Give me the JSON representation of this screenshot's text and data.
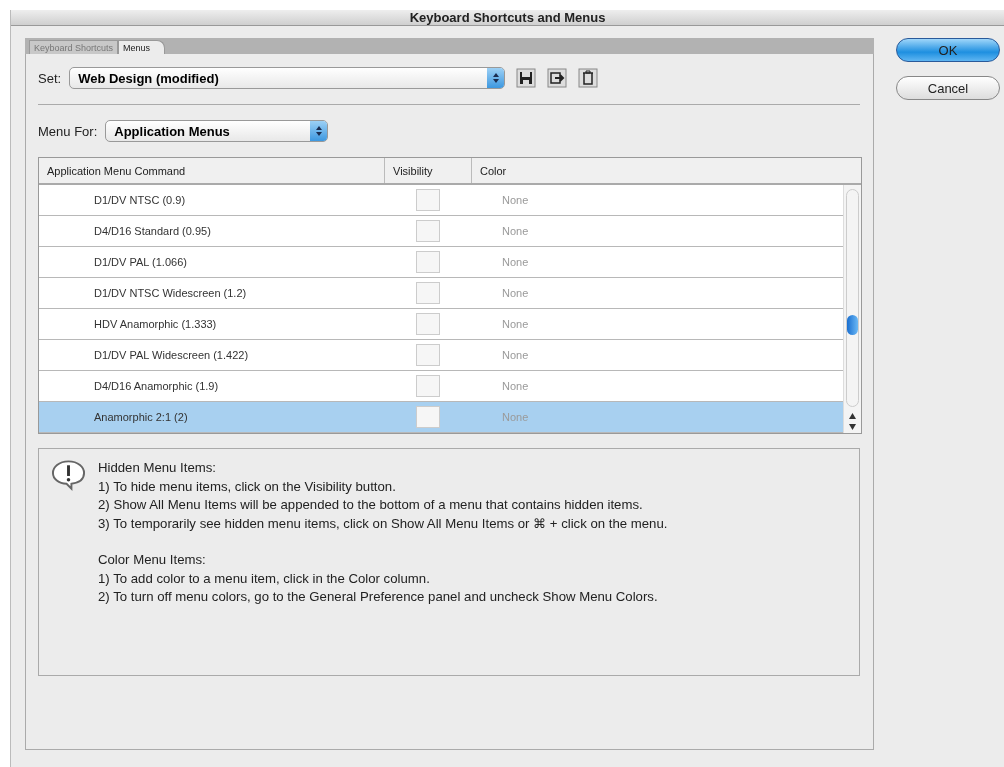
{
  "window": {
    "title": "Keyboard Shortcuts and Menus"
  },
  "tabs": [
    {
      "label": "Keyboard Shortcuts",
      "selected": false
    },
    {
      "label": "Menus",
      "selected": true
    }
  ],
  "set": {
    "label": "Set:",
    "value": "Web Design (modified)"
  },
  "menu_for": {
    "label": "Menu For:",
    "value": "Application Menus"
  },
  "table": {
    "columns": [
      "Application Menu Command",
      "Visibility",
      "Color"
    ],
    "rows": [
      {
        "command": "D1/DV NTSC (0.9)",
        "visible": false,
        "color_name": "None",
        "selected": false
      },
      {
        "command": "D4/D16 Standard (0.95)",
        "visible": false,
        "color_name": "None",
        "selected": false
      },
      {
        "command": "D1/DV PAL (1.066)",
        "visible": false,
        "color_name": "None",
        "selected": false
      },
      {
        "command": "D1/DV NTSC Widescreen (1.2)",
        "visible": false,
        "color_name": "None",
        "selected": false
      },
      {
        "command": "HDV Anamorphic (1.333)",
        "visible": false,
        "color_name": "None",
        "selected": false
      },
      {
        "command": "D1/DV PAL Widescreen (1.422)",
        "visible": false,
        "color_name": "None",
        "selected": false
      },
      {
        "command": "D4/D16 Anamorphic (1.9)",
        "visible": false,
        "color_name": "None",
        "selected": false
      },
      {
        "command": "Anamorphic 2:1 (2)",
        "visible": false,
        "color_name": "None",
        "selected": true
      }
    ]
  },
  "info": [
    {
      "heading": "Hidden Menu Items:",
      "lines": [
        "1) To hide menu items, click on the Visibility button.",
        "2) Show All Menu Items will be appended to the bottom of a menu that contains hidden items.",
        "3) To temporarily see hidden menu items, click on Show All Menu Items or ⌘ + click on the menu."
      ]
    },
    {
      "heading": "Color Menu Items:",
      "lines": [
        "1) To add color to a menu item, click in the Color column.",
        "2) To turn off menu colors, go to the General Preference panel and uncheck Show Menu Colors."
      ]
    }
  ],
  "buttons": [
    {
      "label": "OK",
      "kind": "default"
    },
    {
      "label": "Cancel",
      "kind": "normal"
    }
  ]
}
